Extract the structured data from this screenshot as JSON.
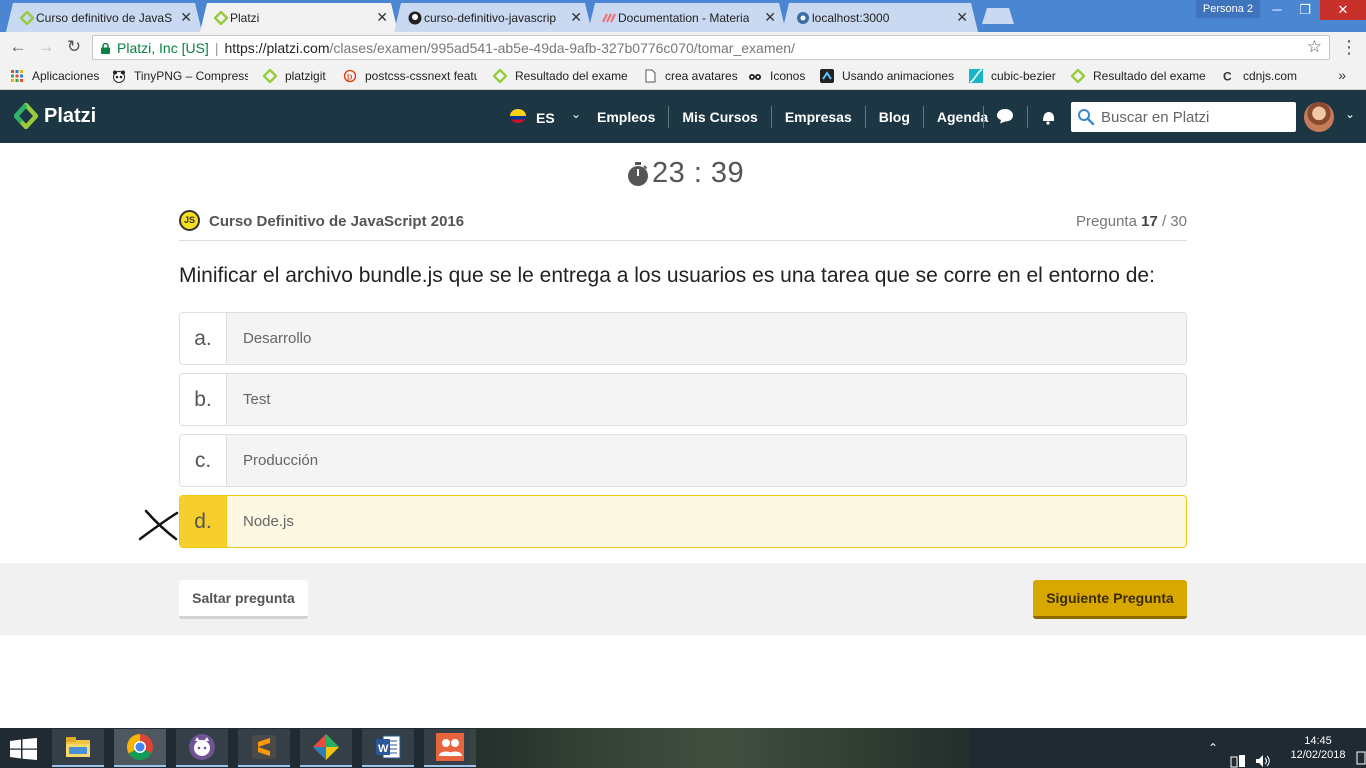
{
  "browser": {
    "tabs": [
      {
        "label": "Curso definitivo de JavaS",
        "active": false
      },
      {
        "label": "Platzi",
        "active": true
      },
      {
        "label": "curso-definitivo-javascrip",
        "active": false
      },
      {
        "label": "Documentation - Materia",
        "active": false
      },
      {
        "label": "localhost:3000",
        "active": false
      }
    ],
    "profile": "Persona 2",
    "secure_label": "Platzi, Inc [US]",
    "url_scheme_host": "https://platzi.com",
    "url_path": "/clases/examen/995ad541-ab5e-49da-9afb-327b0776c070/tomar_examen/",
    "bookmarks": [
      {
        "label": "Aplicaciones",
        "icon": "apps-grid-icon"
      },
      {
        "label": "TinyPNG – Compress",
        "icon": "panda-icon"
      },
      {
        "label": "platzigit",
        "icon": "platzi-icon"
      },
      {
        "label": "postcss-cssnext featu",
        "icon": "postcss-icon"
      },
      {
        "label": "Resultado del exame",
        "icon": "platzi-icon"
      },
      {
        "label": "crea avatares",
        "icon": "page-icon"
      },
      {
        "label": "Iconos",
        "icon": "eye-glasses-icon"
      },
      {
        "label": "Usando animaciones",
        "icon": "mdn-icon"
      },
      {
        "label": "cubic-bezier",
        "icon": "curve-icon"
      },
      {
        "label": "Resultado del exame",
        "icon": "platzi-icon"
      },
      {
        "label": "cdnjs.com",
        "icon": "cdnjs-icon"
      }
    ],
    "bookmarks_overflow": "»"
  },
  "header": {
    "logo": "Platzi",
    "language": "ES",
    "nav": [
      "Empleos",
      "Mis Cursos",
      "Empresas",
      "Blog",
      "Agenda"
    ],
    "search_placeholder": "Buscar en Platzi"
  },
  "exam": {
    "timer": "23 : 39",
    "course_badge": "JS",
    "course_name": "Curso Definitivo de JavaScript 2016",
    "question_prefix": "Pregunta",
    "question_current": "17",
    "question_total": "/ 30",
    "question_text": "Minificar el archivo bundle.js que se le entrega a los usuarios es una tarea que se corre en el entorno de:",
    "options": [
      {
        "letter": "a.",
        "text": "Desarrollo",
        "selected": false
      },
      {
        "letter": "b.",
        "text": "Test",
        "selected": false
      },
      {
        "letter": "c.",
        "text": "Producción",
        "selected": false
      },
      {
        "letter": "d.",
        "text": "Node.js",
        "selected": true
      }
    ],
    "skip_label": "Saltar pregunta",
    "next_label": "Siguiente Pregunta"
  },
  "taskbar": {
    "apps": [
      "file-explorer-icon",
      "chrome-icon",
      "github-desktop-icon",
      "sublime-text-icon",
      "git-extensions-icon",
      "word-icon",
      "people-icon"
    ],
    "time": "14:45",
    "date": "12/02/2018"
  },
  "colors": {
    "platzi_header": "#1c3643",
    "platzi_green": "#98ca3f",
    "selected_option": "#f6cf2c",
    "next_button": "#d9a800"
  }
}
